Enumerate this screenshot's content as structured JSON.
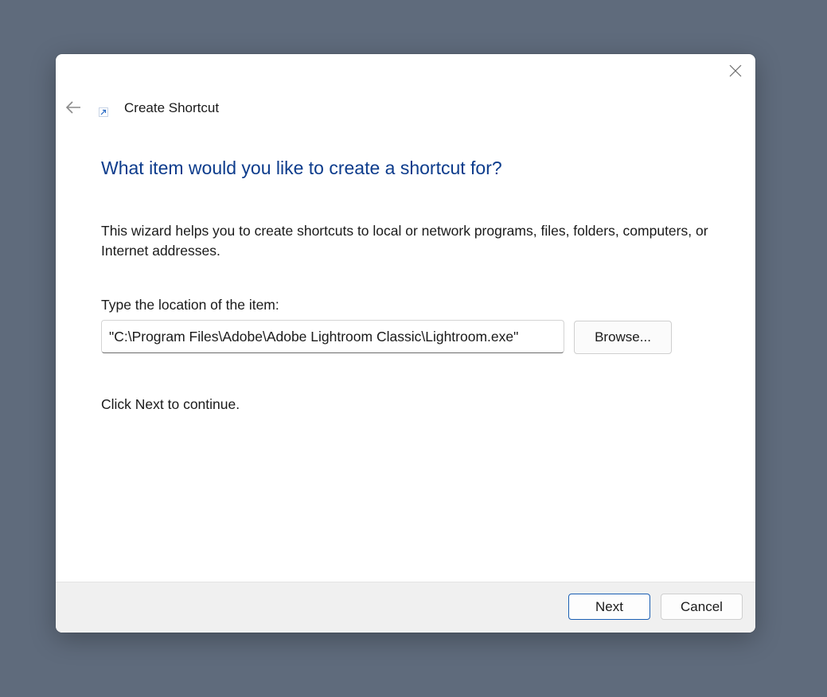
{
  "dialog": {
    "title": "Create Shortcut",
    "heading": "What item would you like to create a shortcut for?",
    "description": "This wizard helps you to create shortcuts to local or network programs, files, folders, computers, or Internet addresses.",
    "location_label": "Type the location of the item:",
    "location_value": "\"C:\\Program Files\\Adobe\\Adobe Lightroom Classic\\Lightroom.exe\"",
    "browse_label": "Browse...",
    "continue_text": "Click Next to continue."
  },
  "footer": {
    "next_label": "Next",
    "cancel_label": "Cancel"
  },
  "icons": {
    "close": "close-icon",
    "back": "back-arrow-icon",
    "app": "shortcut-icon"
  },
  "colors": {
    "background": "#5f6b7c",
    "heading": "#0d3c8c",
    "accent_border": "#1a5fb4"
  }
}
